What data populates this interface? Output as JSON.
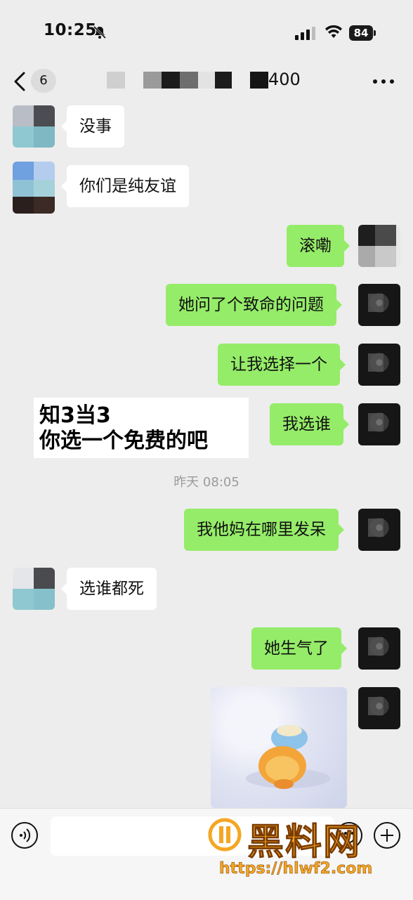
{
  "status_bar": {
    "time": "10:25",
    "battery": "84",
    "icons": [
      "bell-muted-icon",
      "signal-icon",
      "wifi-icon",
      "battery-icon"
    ]
  },
  "nav": {
    "back_badge": "6",
    "title_suffix": "400",
    "icons": [
      "chevron-left-icon",
      "more-icon"
    ]
  },
  "messages": [
    {
      "side": "in",
      "text": "没事"
    },
    {
      "side": "in",
      "text": "你们是纯友谊"
    },
    {
      "side": "out",
      "text": "滚嘞"
    },
    {
      "side": "out",
      "text": "她问了个致命的问题"
    },
    {
      "side": "out",
      "text": "让我选择一个"
    },
    {
      "side": "out",
      "text": "我选谁"
    },
    {
      "side": "out",
      "text": "我他妈在哪里发呆"
    },
    {
      "side": "in",
      "text": "选谁都死"
    },
    {
      "side": "out",
      "text": "她生气了"
    }
  ],
  "timestamp": "昨天 08:05",
  "caption": {
    "line1": "知3当3",
    "line2": "你选一个免费的吧"
  },
  "watermark": {
    "text": "黑料网",
    "url": "https://hlwf2.com"
  },
  "colors": {
    "background": "#ededed",
    "incoming_bubble": "#ffffff",
    "outgoing_bubble": "#95ec69",
    "watermark": "#f5a623"
  }
}
